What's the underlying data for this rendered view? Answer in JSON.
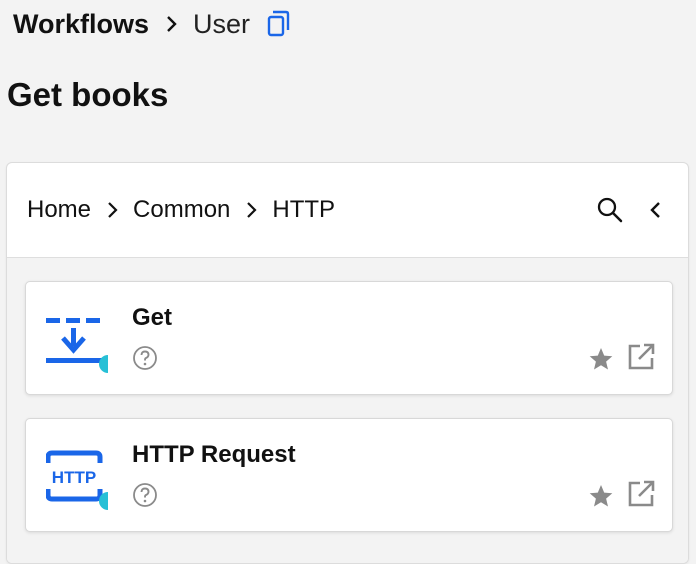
{
  "top_breadcrumb": {
    "root": "Workflows",
    "current": "User"
  },
  "page_title": "Get books",
  "panel": {
    "breadcrumb": [
      "Home",
      "Common",
      "HTTP"
    ]
  },
  "cards": [
    {
      "name": "Get",
      "icon": "download-icon"
    },
    {
      "name": "HTTP Request",
      "icon": "http-icon",
      "icon_text": "HTTP"
    }
  ],
  "colors": {
    "accent": "#1a66e8",
    "status_dot": "#27c0d6",
    "muted_icon": "#8a8a8a"
  }
}
